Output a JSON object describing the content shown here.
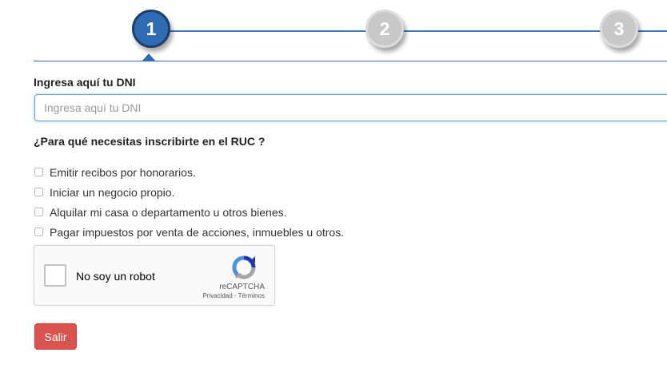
{
  "stepper": {
    "steps": [
      {
        "number": "1",
        "state": "active"
      },
      {
        "number": "2",
        "state": "inactive"
      },
      {
        "number": "3",
        "state": "inactive"
      }
    ],
    "active_color": "#2f6cb3",
    "inactive_color": "#c8c8c8"
  },
  "form": {
    "dni_label": "Ingresa aquí tu DNI",
    "dni_placeholder": "Ingresa aquí tu DNI",
    "dni_value": "",
    "question_label": "¿Para qué necesitas inscribirte en el RUC ?",
    "options": [
      {
        "label": "Emitir recibos por honorarios.",
        "checked": false
      },
      {
        "label": "Iniciar un negocio propio.",
        "checked": false
      },
      {
        "label": "Alquilar mi casa o departamento u otros bienes.",
        "checked": false
      },
      {
        "label": "Pagar impuestos por venta de acciones, inmuebles u otros.",
        "checked": false
      }
    ]
  },
  "recaptcha": {
    "checkbox_label": "No soy un robot",
    "brand": "reCAPTCHA",
    "links": "Privacidad - Términos",
    "icon": "recaptcha-logo-icon"
  },
  "actions": {
    "exit_label": "Salir",
    "exit_color": "#d9534f"
  }
}
